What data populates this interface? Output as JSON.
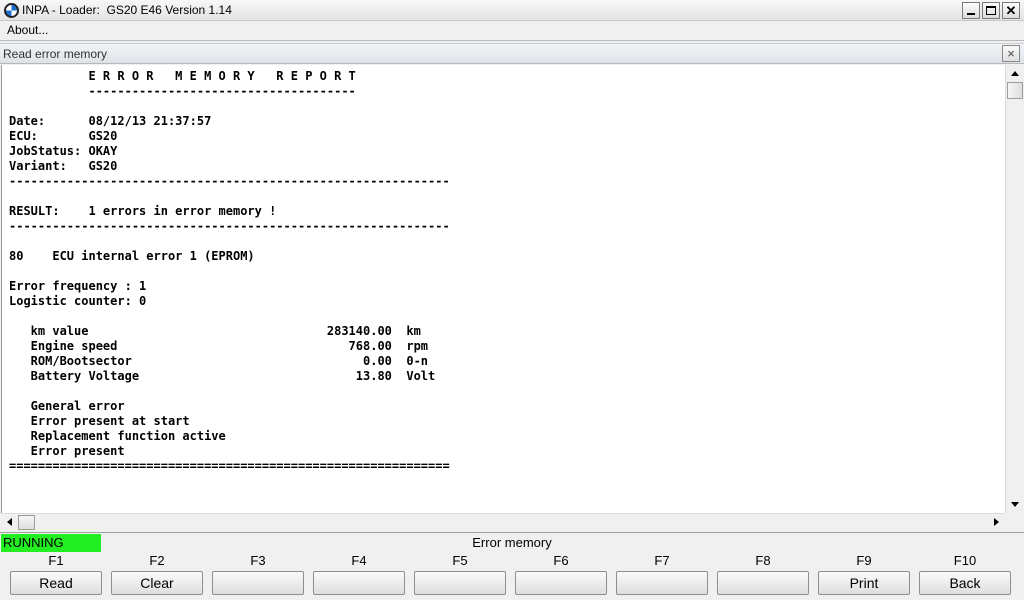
{
  "window": {
    "title": "INPA - Loader:  GS20 E46 Version 1.14",
    "icon": "bmw-logo-icon"
  },
  "menu": {
    "about": "About..."
  },
  "subwindow": {
    "title": "Read error memory",
    "close": "×"
  },
  "report": {
    "lines": [
      "           E R R O R   M E M O R Y   R E P O R T",
      "           -------------------------------------",
      "",
      "Date:      08/12/13 21:37:57",
      "ECU:       GS20",
      "JobStatus: OKAY",
      "Variant:   GS20",
      "-------------------------------------------------------------",
      "",
      "RESULT:    1 errors in error memory !",
      "-------------------------------------------------------------",
      "",
      "80    ECU internal error 1 (EPROM)",
      "",
      "Error frequency : 1",
      "Logistic counter: 0",
      "",
      "   km value                                 283140.00  km",
      "   Engine speed                                768.00  rpm",
      "   ROM/Bootsector                                0.00  0-n",
      "   Battery Voltage                              13.80  Volt",
      "",
      "   General error",
      "   Error present at start",
      "   Replacement function active",
      "   Error present",
      "============================================================="
    ]
  },
  "status": {
    "state": "RUNNING",
    "state_color": "#22ee22",
    "screen_title": "Error memory"
  },
  "fkeys": [
    {
      "key": "F1",
      "label": "Read"
    },
    {
      "key": "F2",
      "label": "Clear"
    },
    {
      "key": "F3",
      "label": ""
    },
    {
      "key": "F4",
      "label": ""
    },
    {
      "key": "F5",
      "label": ""
    },
    {
      "key": "F6",
      "label": ""
    },
    {
      "key": "F7",
      "label": ""
    },
    {
      "key": "F8",
      "label": ""
    },
    {
      "key": "F9",
      "label": "Print"
    },
    {
      "key": "F10",
      "label": "Back"
    }
  ]
}
